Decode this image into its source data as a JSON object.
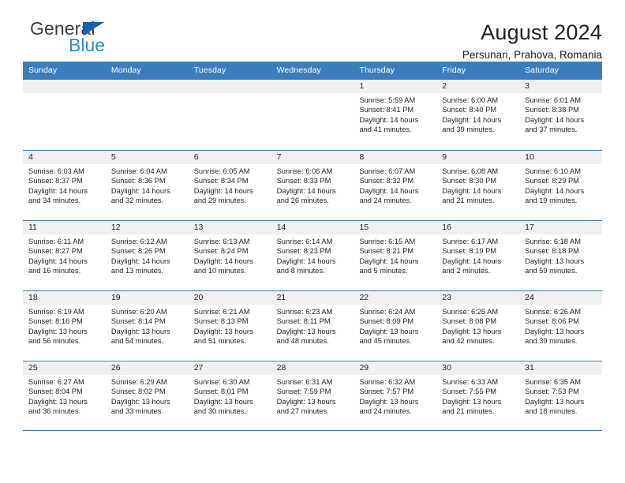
{
  "brand": {
    "name_part1": "General",
    "name_part2": "Blue",
    "triangle_icon": "brand-triangle-icon",
    "accent_dark": "#3c3c3b",
    "accent_blue": "#2a8fd4",
    "triangle_blue": "#1263ae"
  },
  "header": {
    "title": "August 2024",
    "subtitle": "Persunari, Prahova, Romania"
  },
  "calendar": {
    "header_bg": "#3c7ebd",
    "daynum_bg": "#f0f0f0",
    "weekday_headers": [
      "Sunday",
      "Monday",
      "Tuesday",
      "Wednesday",
      "Thursday",
      "Friday",
      "Saturday"
    ],
    "weeks": [
      [
        {
          "day": "",
          "lines": []
        },
        {
          "day": "",
          "lines": []
        },
        {
          "day": "",
          "lines": []
        },
        {
          "day": "",
          "lines": []
        },
        {
          "day": "1",
          "lines": [
            "Sunrise: 5:59 AM",
            "Sunset: 8:41 PM",
            "Daylight: 14 hours",
            "and 41 minutes."
          ]
        },
        {
          "day": "2",
          "lines": [
            "Sunrise: 6:00 AM",
            "Sunset: 8:40 PM",
            "Daylight: 14 hours",
            "and 39 minutes."
          ]
        },
        {
          "day": "3",
          "lines": [
            "Sunrise: 6:01 AM",
            "Sunset: 8:38 PM",
            "Daylight: 14 hours",
            "and 37 minutes."
          ]
        }
      ],
      [
        {
          "day": "4",
          "lines": [
            "Sunrise: 6:03 AM",
            "Sunset: 8:37 PM",
            "Daylight: 14 hours",
            "and 34 minutes."
          ]
        },
        {
          "day": "5",
          "lines": [
            "Sunrise: 6:04 AM",
            "Sunset: 8:36 PM",
            "Daylight: 14 hours",
            "and 32 minutes."
          ]
        },
        {
          "day": "6",
          "lines": [
            "Sunrise: 6:05 AM",
            "Sunset: 8:34 PM",
            "Daylight: 14 hours",
            "and 29 minutes."
          ]
        },
        {
          "day": "7",
          "lines": [
            "Sunrise: 6:06 AM",
            "Sunset: 8:33 PM",
            "Daylight: 14 hours",
            "and 26 minutes."
          ]
        },
        {
          "day": "8",
          "lines": [
            "Sunrise: 6:07 AM",
            "Sunset: 8:32 PM",
            "Daylight: 14 hours",
            "and 24 minutes."
          ]
        },
        {
          "day": "9",
          "lines": [
            "Sunrise: 6:08 AM",
            "Sunset: 8:30 PM",
            "Daylight: 14 hours",
            "and 21 minutes."
          ]
        },
        {
          "day": "10",
          "lines": [
            "Sunrise: 6:10 AM",
            "Sunset: 8:29 PM",
            "Daylight: 14 hours",
            "and 19 minutes."
          ]
        }
      ],
      [
        {
          "day": "11",
          "lines": [
            "Sunrise: 6:11 AM",
            "Sunset: 8:27 PM",
            "Daylight: 14 hours",
            "and 16 minutes."
          ]
        },
        {
          "day": "12",
          "lines": [
            "Sunrise: 6:12 AM",
            "Sunset: 8:26 PM",
            "Daylight: 14 hours",
            "and 13 minutes."
          ]
        },
        {
          "day": "13",
          "lines": [
            "Sunrise: 6:13 AM",
            "Sunset: 8:24 PM",
            "Daylight: 14 hours",
            "and 10 minutes."
          ]
        },
        {
          "day": "14",
          "lines": [
            "Sunrise: 6:14 AM",
            "Sunset: 8:23 PM",
            "Daylight: 14 hours",
            "and 8 minutes."
          ]
        },
        {
          "day": "15",
          "lines": [
            "Sunrise: 6:15 AM",
            "Sunset: 8:21 PM",
            "Daylight: 14 hours",
            "and 5 minutes."
          ]
        },
        {
          "day": "16",
          "lines": [
            "Sunrise: 6:17 AM",
            "Sunset: 8:19 PM",
            "Daylight: 14 hours",
            "and 2 minutes."
          ]
        },
        {
          "day": "17",
          "lines": [
            "Sunrise: 6:18 AM",
            "Sunset: 8:18 PM",
            "Daylight: 13 hours",
            "and 59 minutes."
          ]
        }
      ],
      [
        {
          "day": "18",
          "lines": [
            "Sunrise: 6:19 AM",
            "Sunset: 8:16 PM",
            "Daylight: 13 hours",
            "and 56 minutes."
          ]
        },
        {
          "day": "19",
          "lines": [
            "Sunrise: 6:20 AM",
            "Sunset: 8:14 PM",
            "Daylight: 13 hours",
            "and 54 minutes."
          ]
        },
        {
          "day": "20",
          "lines": [
            "Sunrise: 6:21 AM",
            "Sunset: 8:13 PM",
            "Daylight: 13 hours",
            "and 51 minutes."
          ]
        },
        {
          "day": "21",
          "lines": [
            "Sunrise: 6:23 AM",
            "Sunset: 8:11 PM",
            "Daylight: 13 hours",
            "and 48 minutes."
          ]
        },
        {
          "day": "22",
          "lines": [
            "Sunrise: 6:24 AM",
            "Sunset: 8:09 PM",
            "Daylight: 13 hours",
            "and 45 minutes."
          ]
        },
        {
          "day": "23",
          "lines": [
            "Sunrise: 6:25 AM",
            "Sunset: 8:08 PM",
            "Daylight: 13 hours",
            "and 42 minutes."
          ]
        },
        {
          "day": "24",
          "lines": [
            "Sunrise: 6:26 AM",
            "Sunset: 8:06 PM",
            "Daylight: 13 hours",
            "and 39 minutes."
          ]
        }
      ],
      [
        {
          "day": "25",
          "lines": [
            "Sunrise: 6:27 AM",
            "Sunset: 8:04 PM",
            "Daylight: 13 hours",
            "and 36 minutes."
          ]
        },
        {
          "day": "26",
          "lines": [
            "Sunrise: 6:29 AM",
            "Sunset: 8:02 PM",
            "Daylight: 13 hours",
            "and 33 minutes."
          ]
        },
        {
          "day": "27",
          "lines": [
            "Sunrise: 6:30 AM",
            "Sunset: 8:01 PM",
            "Daylight: 13 hours",
            "and 30 minutes."
          ]
        },
        {
          "day": "28",
          "lines": [
            "Sunrise: 6:31 AM",
            "Sunset: 7:59 PM",
            "Daylight: 13 hours",
            "and 27 minutes."
          ]
        },
        {
          "day": "29",
          "lines": [
            "Sunrise: 6:32 AM",
            "Sunset: 7:57 PM",
            "Daylight: 13 hours",
            "and 24 minutes."
          ]
        },
        {
          "day": "30",
          "lines": [
            "Sunrise: 6:33 AM",
            "Sunset: 7:55 PM",
            "Daylight: 13 hours",
            "and 21 minutes."
          ]
        },
        {
          "day": "31",
          "lines": [
            "Sunrise: 6:35 AM",
            "Sunset: 7:53 PM",
            "Daylight: 13 hours",
            "and 18 minutes."
          ]
        }
      ]
    ]
  }
}
